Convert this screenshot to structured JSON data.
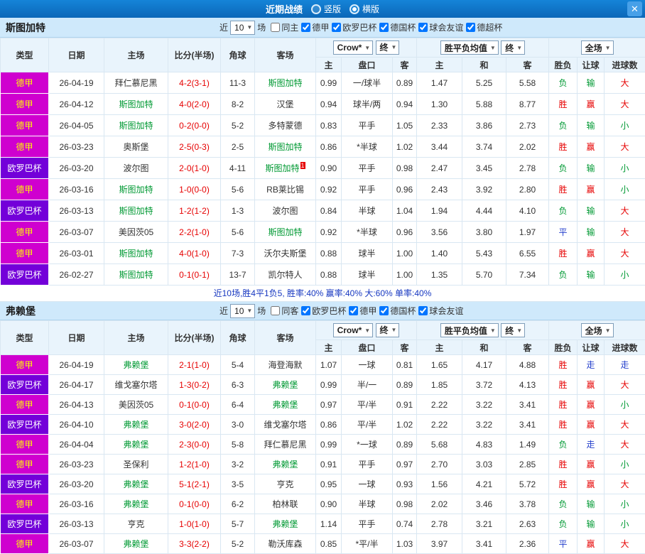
{
  "titlebar": {
    "title": "近期战绩",
    "vertical_label": "竖版",
    "horizontal_label": "横版",
    "selected": "横版",
    "close_icon": "✕"
  },
  "colors": {
    "titlebar_blue": "#0d72c6",
    "section_header_blue": "#cfe9fb",
    "league_magenta": "#cf00cf",
    "league_purple": "#7300d9",
    "win_red": "#e60000",
    "loss_green": "#009933",
    "draw_blue": "#2540cc",
    "focal_team_green": "#009933",
    "score_red": "#e60000",
    "summary_blue": "#1536c0"
  },
  "sections": [
    {
      "team": "斯图加特",
      "filter": {
        "near_label": "近",
        "count": "10",
        "games_label": "场",
        "checkboxes": [
          {
            "label": "同主",
            "checked": false
          },
          {
            "label": "德甲",
            "checked": true
          },
          {
            "label": "欧罗巴杯",
            "checked": true
          },
          {
            "label": "德国杯",
            "checked": true
          },
          {
            "label": "球会友谊",
            "checked": true
          },
          {
            "label": "德超杯",
            "checked": true
          }
        ]
      },
      "columns": {
        "type": "类型",
        "date": "日期",
        "home": "主场",
        "score": "比分(半场)",
        "corners": "角球",
        "away": "客场",
        "sub": [
          "主",
          "盘口",
          "客",
          "主",
          "和",
          "客",
          "胜负",
          "让球",
          "进球数"
        ]
      },
      "dropdowns": {
        "bookmaker": "Crow*",
        "final1": "终",
        "mean": "胜平负均值",
        "final2": "终",
        "fulltime": "全场"
      },
      "rows": [
        {
          "league": "德甲",
          "league_style": "magenta",
          "date": "26-04-19",
          "home": "拜仁慕尼黑",
          "home_focal": false,
          "score": "4-2(3-1)",
          "corners": "11-3",
          "away": "斯图加特",
          "away_focal": true,
          "asian": {
            "home": "0.99",
            "handicap": "一/球半",
            "away": "0.89"
          },
          "euro": {
            "home": "1.47",
            "draw": "5.25",
            "away": "5.58"
          },
          "result": {
            "text": "负",
            "color": "green"
          },
          "handicap_result": {
            "text": "输",
            "color": "green"
          },
          "goals": {
            "text": "大",
            "color": "red"
          }
        },
        {
          "league": "德甲",
          "league_style": "magenta",
          "date": "26-04-12",
          "home": "斯图加特",
          "home_focal": true,
          "score": "4-0(2-0)",
          "corners": "8-2",
          "away": "汉堡",
          "away_focal": false,
          "asian": {
            "home": "0.94",
            "handicap": "球半/两",
            "away": "0.94"
          },
          "euro": {
            "home": "1.30",
            "draw": "5.88",
            "away": "8.77"
          },
          "result": {
            "text": "胜",
            "color": "red"
          },
          "handicap_result": {
            "text": "赢",
            "color": "red"
          },
          "goals": {
            "text": "大",
            "color": "red"
          }
        },
        {
          "league": "德甲",
          "league_style": "magenta",
          "date": "26-04-05",
          "home": "斯图加特",
          "home_focal": true,
          "score": "0-2(0-0)",
          "corners": "5-2",
          "away": "多特蒙德",
          "away_focal": false,
          "asian": {
            "home": "0.83",
            "handicap": "平手",
            "away": "1.05"
          },
          "euro": {
            "home": "2.33",
            "draw": "3.86",
            "away": "2.73"
          },
          "result": {
            "text": "负",
            "color": "green"
          },
          "handicap_result": {
            "text": "输",
            "color": "green"
          },
          "goals": {
            "text": "小",
            "color": "green"
          }
        },
        {
          "league": "德甲",
          "league_style": "magenta",
          "date": "26-03-23",
          "home": "奥斯堡",
          "home_focal": false,
          "score": "2-5(0-3)",
          "corners": "2-5",
          "away": "斯图加特",
          "away_focal": true,
          "asian": {
            "home": "0.86",
            "handicap": "*半球",
            "away": "1.02"
          },
          "euro": {
            "home": "3.44",
            "draw": "3.74",
            "away": "2.02"
          },
          "result": {
            "text": "胜",
            "color": "red"
          },
          "handicap_result": {
            "text": "赢",
            "color": "red"
          },
          "goals": {
            "text": "大",
            "color": "red"
          }
        },
        {
          "league": "欧罗巴杯",
          "league_style": "purple",
          "date": "26-03-20",
          "home": "波尔图",
          "home_focal": false,
          "score": "2-0(1-0)",
          "corners": "4-11",
          "away": "斯图加特",
          "away_focal": true,
          "away_sup": "1",
          "asian": {
            "home": "0.90",
            "handicap": "平手",
            "away": "0.98"
          },
          "euro": {
            "home": "2.47",
            "draw": "3.45",
            "away": "2.78"
          },
          "result": {
            "text": "负",
            "color": "green"
          },
          "handicap_result": {
            "text": "输",
            "color": "green"
          },
          "goals": {
            "text": "小",
            "color": "green"
          }
        },
        {
          "league": "德甲",
          "league_style": "magenta",
          "date": "26-03-16",
          "home": "斯图加特",
          "home_focal": true,
          "score": "1-0(0-0)",
          "corners": "5-6",
          "away": "RB莱比锡",
          "away_focal": false,
          "asian": {
            "home": "0.92",
            "handicap": "平手",
            "away": "0.96"
          },
          "euro": {
            "home": "2.43",
            "draw": "3.92",
            "away": "2.80"
          },
          "result": {
            "text": "胜",
            "color": "red"
          },
          "handicap_result": {
            "text": "赢",
            "color": "red"
          },
          "goals": {
            "text": "小",
            "color": "green"
          }
        },
        {
          "league": "欧罗巴杯",
          "league_style": "purple",
          "date": "26-03-13",
          "home": "斯图加特",
          "home_focal": true,
          "score": "1-2(1-2)",
          "corners": "1-3",
          "away": "波尔图",
          "away_focal": false,
          "asian": {
            "home": "0.84",
            "handicap": "半球",
            "away": "1.04"
          },
          "euro": {
            "home": "1.94",
            "draw": "4.44",
            "away": "4.10"
          },
          "result": {
            "text": "负",
            "color": "green"
          },
          "handicap_result": {
            "text": "输",
            "color": "green"
          },
          "goals": {
            "text": "大",
            "color": "red"
          }
        },
        {
          "league": "德甲",
          "league_style": "magenta",
          "date": "26-03-07",
          "home": "美因茨05",
          "home_focal": false,
          "score": "2-2(1-0)",
          "corners": "5-6",
          "away": "斯图加特",
          "away_focal": true,
          "asian": {
            "home": "0.92",
            "handicap": "*半球",
            "away": "0.96"
          },
          "euro": {
            "home": "3.56",
            "draw": "3.80",
            "away": "1.97"
          },
          "result": {
            "text": "平",
            "color": "blue"
          },
          "handicap_result": {
            "text": "输",
            "color": "green"
          },
          "goals": {
            "text": "大",
            "color": "red"
          }
        },
        {
          "league": "德甲",
          "league_style": "magenta",
          "date": "26-03-01",
          "home": "斯图加特",
          "home_focal": true,
          "score": "4-0(1-0)",
          "corners": "7-3",
          "away": "沃尔夫斯堡",
          "away_focal": false,
          "asian": {
            "home": "0.88",
            "handicap": "球半",
            "away": "1.00"
          },
          "euro": {
            "home": "1.40",
            "draw": "5.43",
            "away": "6.55"
          },
          "result": {
            "text": "胜",
            "color": "red"
          },
          "handicap_result": {
            "text": "赢",
            "color": "red"
          },
          "goals": {
            "text": "大",
            "color": "red"
          }
        },
        {
          "league": "欧罗巴杯",
          "league_style": "purple",
          "date": "26-02-27",
          "home": "斯图加特",
          "home_focal": true,
          "score": "0-1(0-1)",
          "corners": "13-7",
          "away": "凯尔特人",
          "away_focal": false,
          "asian": {
            "home": "0.88",
            "handicap": "球半",
            "away": "1.00"
          },
          "euro": {
            "home": "1.35",
            "draw": "5.70",
            "away": "7.34"
          },
          "result": {
            "text": "负",
            "color": "green"
          },
          "handicap_result": {
            "text": "输",
            "color": "green"
          },
          "goals": {
            "text": "小",
            "color": "green"
          }
        }
      ],
      "summary": "近10场,胜4平1负5, 胜率:40% 赢率:40% 大:60% 单率:40%"
    },
    {
      "team": "弗赖堡",
      "filter": {
        "near_label": "近",
        "count": "10",
        "games_label": "场",
        "checkboxes": [
          {
            "label": "同客",
            "checked": false
          },
          {
            "label": "欧罗巴杯",
            "checked": true
          },
          {
            "label": "德甲",
            "checked": true
          },
          {
            "label": "德国杯",
            "checked": true
          },
          {
            "label": "球会友谊",
            "checked": true
          }
        ]
      },
      "columns": {
        "type": "类型",
        "date": "日期",
        "home": "主场",
        "score": "比分(半场)",
        "corners": "角球",
        "away": "客场",
        "sub": [
          "主",
          "盘口",
          "客",
          "主",
          "和",
          "客",
          "胜负",
          "让球",
          "进球数"
        ]
      },
      "dropdowns": {
        "bookmaker": "Crow*",
        "final1": "终",
        "mean": "胜平负均值",
        "final2": "终",
        "fulltime": "全场"
      },
      "rows": [
        {
          "league": "德甲",
          "league_style": "magenta",
          "date": "26-04-19",
          "home": "弗赖堡",
          "home_focal": true,
          "score": "2-1(1-0)",
          "corners": "5-4",
          "away": "海登海默",
          "away_focal": false,
          "asian": {
            "home": "1.07",
            "handicap": "一球",
            "away": "0.81"
          },
          "euro": {
            "home": "1.65",
            "draw": "4.17",
            "away": "4.88"
          },
          "result": {
            "text": "胜",
            "color": "red"
          },
          "handicap_result": {
            "text": "走",
            "color": "blue"
          },
          "goals": {
            "text": "走",
            "color": "blue"
          }
        },
        {
          "league": "欧罗巴杯",
          "league_style": "purple",
          "date": "26-04-17",
          "home": "维戈塞尔塔",
          "home_focal": false,
          "score": "1-3(0-2)",
          "corners": "6-3",
          "away": "弗赖堡",
          "away_focal": true,
          "asian": {
            "home": "0.99",
            "handicap": "半/一",
            "away": "0.89"
          },
          "euro": {
            "home": "1.85",
            "draw": "3.72",
            "away": "4.13"
          },
          "result": {
            "text": "胜",
            "color": "red"
          },
          "handicap_result": {
            "text": "赢",
            "color": "red"
          },
          "goals": {
            "text": "大",
            "color": "red"
          }
        },
        {
          "league": "德甲",
          "league_style": "magenta",
          "date": "26-04-13",
          "home": "美因茨05",
          "home_focal": false,
          "score": "0-1(0-0)",
          "corners": "6-4",
          "away": "弗赖堡",
          "away_focal": true,
          "asian": {
            "home": "0.97",
            "handicap": "平/半",
            "away": "0.91"
          },
          "euro": {
            "home": "2.22",
            "draw": "3.22",
            "away": "3.41"
          },
          "result": {
            "text": "胜",
            "color": "red"
          },
          "handicap_result": {
            "text": "赢",
            "color": "red"
          },
          "goals": {
            "text": "小",
            "color": "green"
          }
        },
        {
          "league": "欧罗巴杯",
          "league_style": "purple",
          "date": "26-04-10",
          "home": "弗赖堡",
          "home_focal": true,
          "score": "3-0(2-0)",
          "corners": "3-0",
          "away": "维戈塞尔塔",
          "away_focal": false,
          "asian": {
            "home": "0.86",
            "handicap": "平/半",
            "away": "1.02"
          },
          "euro": {
            "home": "2.22",
            "draw": "3.22",
            "away": "3.41"
          },
          "result": {
            "text": "胜",
            "color": "red"
          },
          "handicap_result": {
            "text": "赢",
            "color": "red"
          },
          "goals": {
            "text": "大",
            "color": "red"
          }
        },
        {
          "league": "德甲",
          "league_style": "magenta",
          "date": "26-04-04",
          "home": "弗赖堡",
          "home_focal": true,
          "score": "2-3(0-0)",
          "corners": "5-8",
          "away": "拜仁慕尼黑",
          "away_focal": false,
          "asian": {
            "home": "0.99",
            "handicap": "*一球",
            "away": "0.89"
          },
          "euro": {
            "home": "5.68",
            "draw": "4.83",
            "away": "1.49"
          },
          "result": {
            "text": "负",
            "color": "green"
          },
          "handicap_result": {
            "text": "走",
            "color": "blue"
          },
          "goals": {
            "text": "大",
            "color": "red"
          }
        },
        {
          "league": "德甲",
          "league_style": "magenta",
          "date": "26-03-23",
          "home": "圣保利",
          "home_focal": false,
          "score": "1-2(1-0)",
          "corners": "3-2",
          "away": "弗赖堡",
          "away_focal": true,
          "asian": {
            "home": "0.91",
            "handicap": "平手",
            "away": "0.97"
          },
          "euro": {
            "home": "2.70",
            "draw": "3.03",
            "away": "2.85"
          },
          "result": {
            "text": "胜",
            "color": "red"
          },
          "handicap_result": {
            "text": "赢",
            "color": "red"
          },
          "goals": {
            "text": "小",
            "color": "green"
          }
        },
        {
          "league": "欧罗巴杯",
          "league_style": "purple",
          "date": "26-03-20",
          "home": "弗赖堡",
          "home_focal": true,
          "score": "5-1(2-1)",
          "corners": "3-5",
          "away": "亨克",
          "away_focal": false,
          "asian": {
            "home": "0.95",
            "handicap": "一球",
            "away": "0.93"
          },
          "euro": {
            "home": "1.56",
            "draw": "4.21",
            "away": "5.72"
          },
          "result": {
            "text": "胜",
            "color": "red"
          },
          "handicap_result": {
            "text": "赢",
            "color": "red"
          },
          "goals": {
            "text": "大",
            "color": "red"
          }
        },
        {
          "league": "德甲",
          "league_style": "magenta",
          "date": "26-03-16",
          "home": "弗赖堡",
          "home_focal": true,
          "score": "0-1(0-0)",
          "corners": "6-2",
          "away": "柏林联",
          "away_focal": false,
          "asian": {
            "home": "0.90",
            "handicap": "半球",
            "away": "0.98"
          },
          "euro": {
            "home": "2.02",
            "draw": "3.46",
            "away": "3.78"
          },
          "result": {
            "text": "负",
            "color": "green"
          },
          "handicap_result": {
            "text": "输",
            "color": "green"
          },
          "goals": {
            "text": "小",
            "color": "green"
          }
        },
        {
          "league": "欧罗巴杯",
          "league_style": "purple",
          "date": "26-03-13",
          "home": "亨克",
          "home_focal": false,
          "score": "1-0(1-0)",
          "corners": "5-7",
          "away": "弗赖堡",
          "away_focal": true,
          "asian": {
            "home": "1.14",
            "handicap": "平手",
            "away": "0.74"
          },
          "euro": {
            "home": "2.78",
            "draw": "3.21",
            "away": "2.63"
          },
          "result": {
            "text": "负",
            "color": "green"
          },
          "handicap_result": {
            "text": "输",
            "color": "green"
          },
          "goals": {
            "text": "小",
            "color": "green"
          }
        },
        {
          "league": "德甲",
          "league_style": "magenta",
          "date": "26-03-07",
          "home": "弗赖堡",
          "home_focal": true,
          "score": "3-3(2-2)",
          "corners": "5-2",
          "away": "勒沃库森",
          "away_focal": false,
          "asian": {
            "home": "0.85",
            "handicap": "*平/半",
            "away": "1.03"
          },
          "euro": {
            "home": "3.97",
            "draw": "3.41",
            "away": "2.36"
          },
          "result": {
            "text": "平",
            "color": "blue"
          },
          "handicap_result": {
            "text": "赢",
            "color": "red"
          },
          "goals": {
            "text": "大",
            "color": "red"
          }
        }
      ]
    }
  ]
}
